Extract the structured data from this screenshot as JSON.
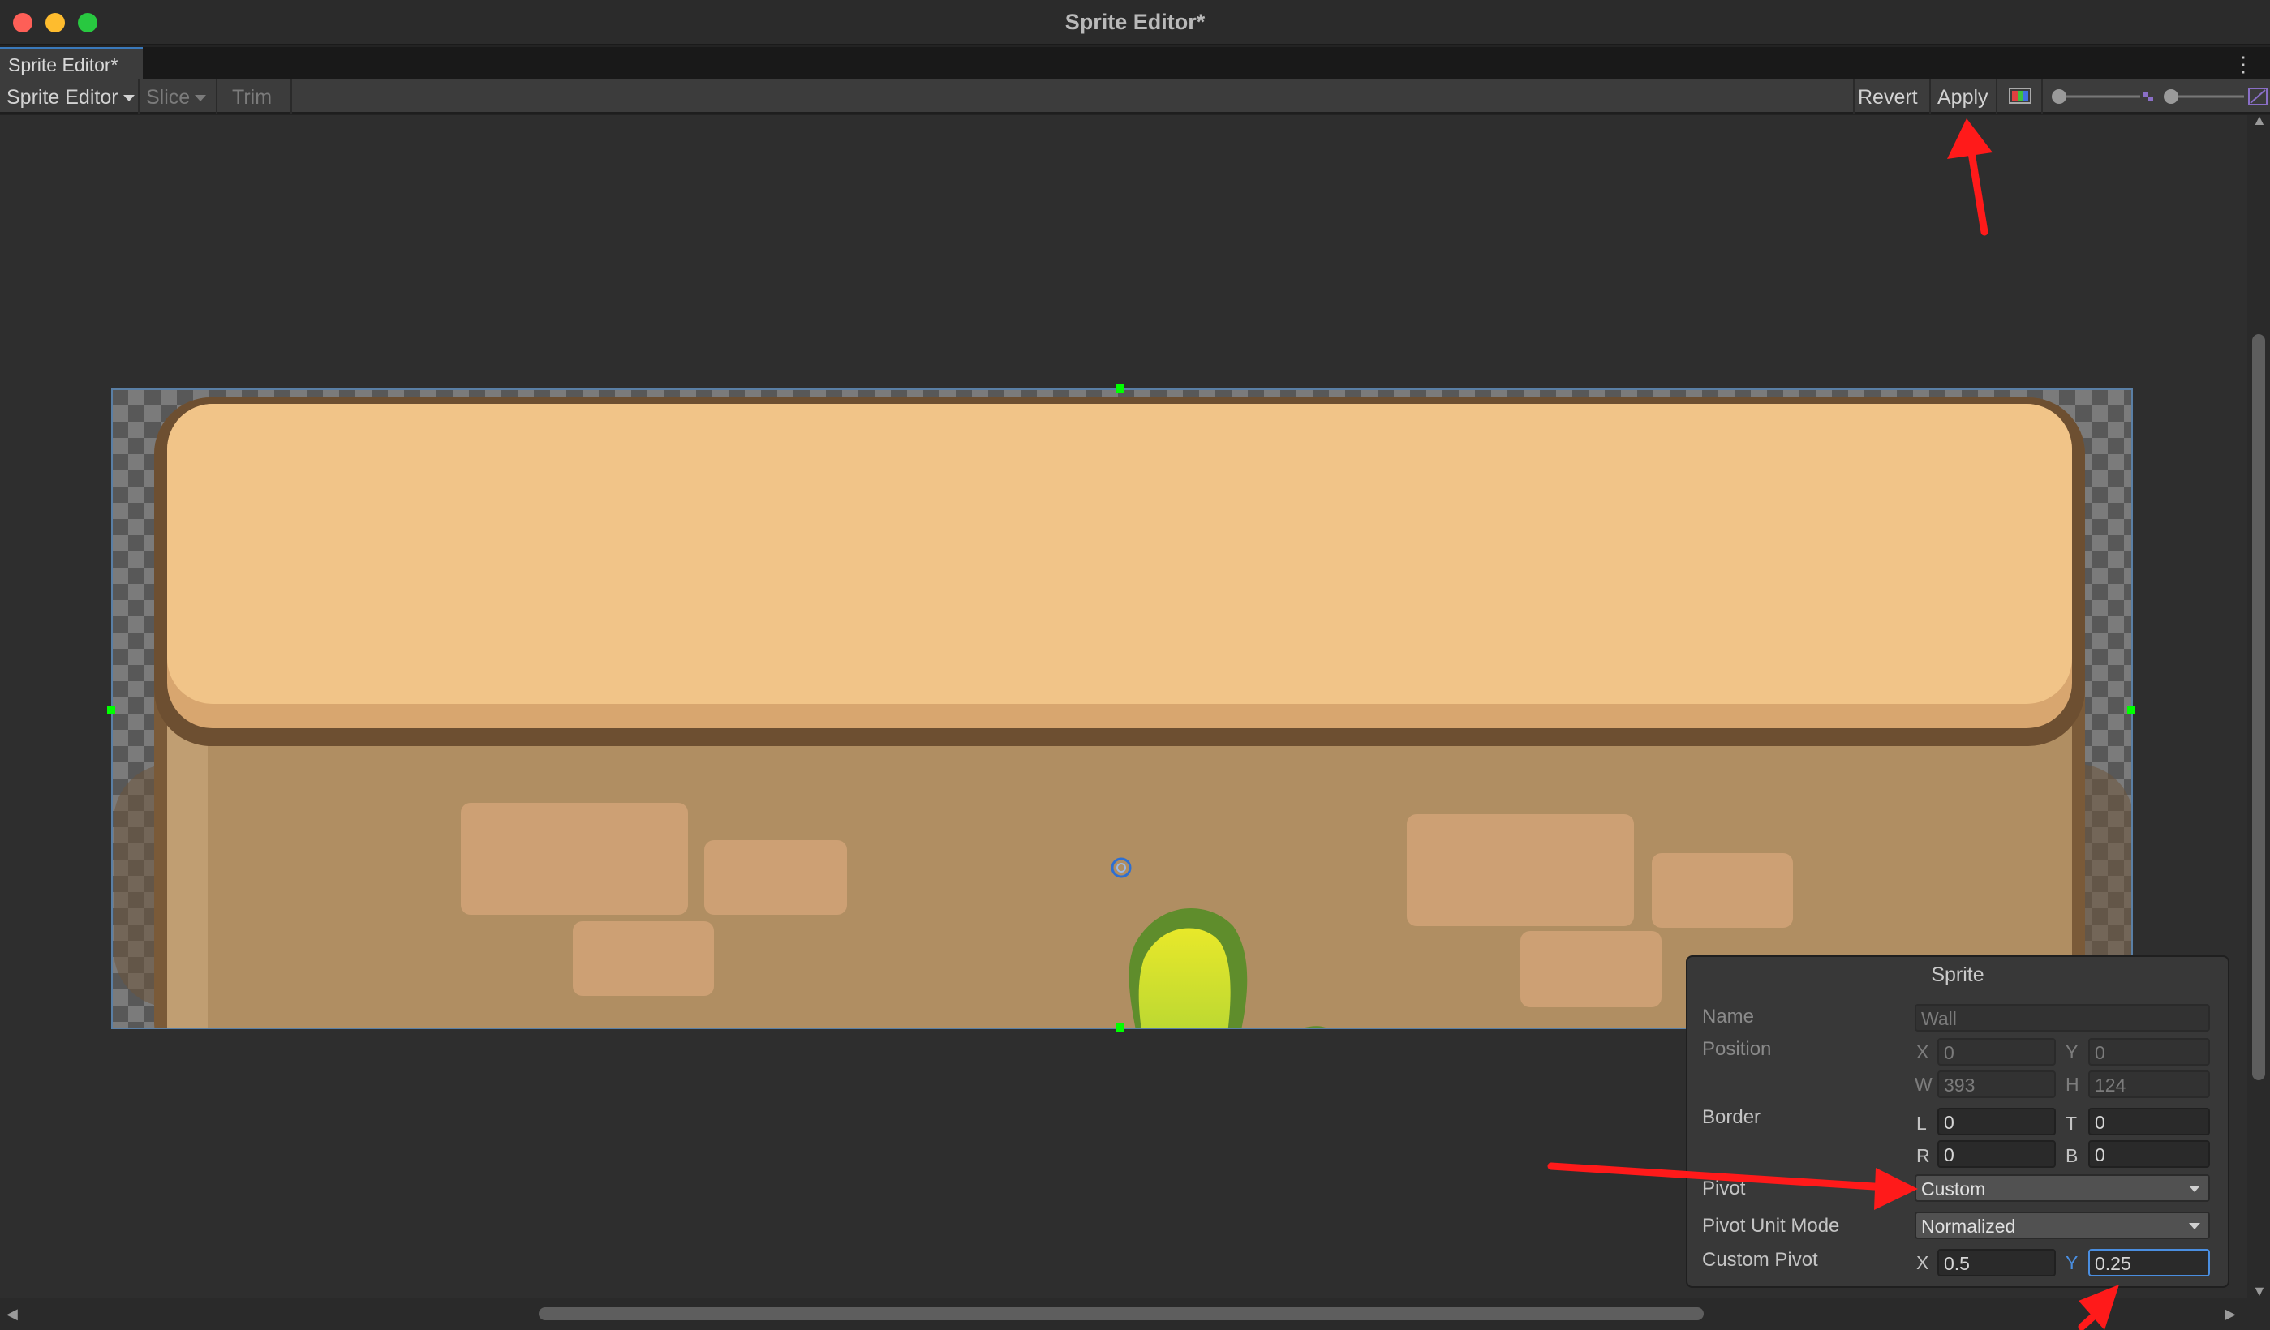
{
  "window": {
    "title": "Sprite Editor*"
  },
  "tab": {
    "label": "Sprite Editor*"
  },
  "toolbar": {
    "mode_label": "Sprite Editor",
    "slice_label": "Slice",
    "trim_label": "Trim",
    "revert_label": "Revert",
    "apply_label": "Apply"
  },
  "sprite_panel": {
    "title": "Sprite",
    "name_label": "Name",
    "name_value": "Wall",
    "position_label": "Position",
    "x_label": "X",
    "x_value": "0",
    "y_label": "Y",
    "y_value": "0",
    "w_label": "W",
    "w_value": "393",
    "h_label": "H",
    "h_value": "124",
    "border_label": "Border",
    "l_label": "L",
    "l_value": "0",
    "t_label": "T",
    "t_value": "0",
    "r_label": "R",
    "r_value": "0",
    "b_label": "B",
    "b_value": "0",
    "pivot_label": "Pivot",
    "pivot_value": "Custom",
    "pivot_unit_label": "Pivot Unit Mode",
    "pivot_unit_value": "Normalized",
    "custom_pivot_label": "Custom Pivot",
    "cp_x_label": "X",
    "cp_x_value": "0.5",
    "cp_y_label": "Y",
    "cp_y_value": "0.25"
  },
  "colors": {
    "annotation_arrow": "#ff1a1a",
    "selection_handle": "#00ff00",
    "wall_top": "#f1c488",
    "wall_body": "#b08e62",
    "wall_outline": "#7a5a38",
    "brick": "#cda074",
    "plant": "#a6d12f"
  },
  "icons": [
    "color-channel-icon",
    "zoom-slider-icon",
    "mip-slider-icon",
    "alpha-icon"
  ]
}
